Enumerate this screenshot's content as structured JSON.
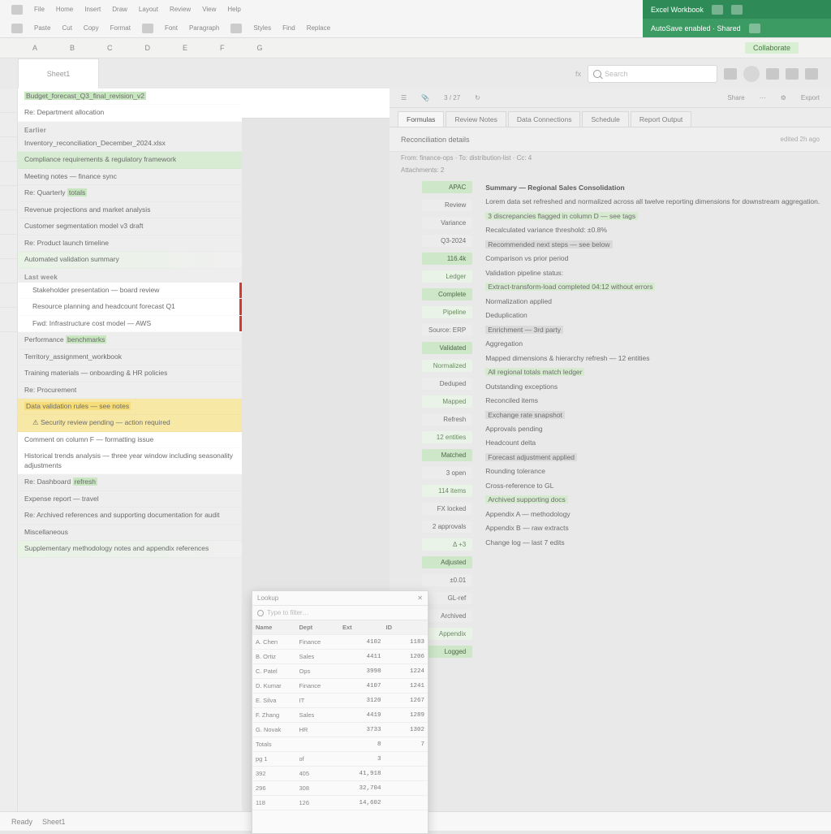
{
  "ribbon": {
    "row1": [
      "File",
      "Home",
      "Insert",
      "Draw",
      "Layout",
      "Review",
      "View",
      "Help"
    ],
    "row2": [
      "Paste",
      "Cut",
      "Copy",
      "Format",
      "Font",
      "Paragraph",
      "Styles",
      "Find",
      "Replace"
    ],
    "greenTitle": "Excel Workbook",
    "greenSub": "AutoSave enabled · Shared",
    "greenTab": "Collaborate"
  },
  "subbar": {
    "cols": [
      "A",
      "B",
      "C",
      "D",
      "E",
      "F",
      "G"
    ]
  },
  "dochead": {
    "tab": "Sheet1",
    "searchPlaceholder": "Search"
  },
  "messages": {
    "groups": [
      {
        "head": "",
        "items": [
          {
            "t": "Budget_forecast_Q3_final_revision_v2",
            "cls": "white hl-green-part"
          },
          {
            "t": "Re: Department allocation",
            "cls": "white"
          }
        ]
      },
      {
        "head": "Earlier",
        "items": [
          {
            "t": "Inventory_reconciliation_December_2024.xlsx",
            "cls": ""
          },
          {
            "t": "Compliance requirements & regulatory framework",
            "cls": "greenband"
          },
          {
            "t": "Meeting notes — finance sync",
            "cls": ""
          },
          {
            "t": "Re: Quarterly totals",
            "cls": "hl-green-part"
          }
        ]
      },
      {
        "head": "",
        "items": [
          {
            "t": "Revenue projections and market analysis",
            "cls": ""
          },
          {
            "t": "Customer segmentation model v3 draft",
            "cls": ""
          },
          {
            "t": "Re: Product launch timeline",
            "cls": ""
          },
          {
            "t": "Automated validation summary",
            "cls": "greenlite"
          }
        ]
      },
      {
        "head": "Last week",
        "items": [
          {
            "t": "Stakeholder presentation — board review",
            "cls": "white redbar indent"
          },
          {
            "t": "Resource planning and headcount forecast Q1",
            "cls": "white redbar indent"
          },
          {
            "t": "Fwd: Infrastructure cost model — AWS",
            "cls": "white redbar indent"
          }
        ]
      },
      {
        "head": "",
        "items": [
          {
            "t": "Performance benchmarks",
            "cls": "hl-green-part"
          },
          {
            "t": "Territory_assignment_workbook",
            "cls": ""
          },
          {
            "t": "Training materials — onboarding & HR policies",
            "cls": ""
          },
          {
            "t": "Re: Procurement",
            "cls": ""
          },
          {
            "t": "Data validation rules — see notes",
            "cls": "yellowband hl-yellow-part"
          },
          {
            "t": "⚠ Security review pending — action required",
            "cls": "yellowband indent"
          },
          {
            "t": "Comment on column F — formatting issue",
            "cls": "white"
          },
          {
            "t": "Historical trends analysis — three year window including seasonality adjustments",
            "cls": "white"
          },
          {
            "t": "Re: Dashboard refresh",
            "cls": "hl-green-part"
          },
          {
            "t": "Expense report — travel",
            "cls": ""
          },
          {
            "t": "Re: Archived references and supporting documentation for audit",
            "cls": ""
          },
          {
            "t": "Miscellaneous",
            "cls": ""
          },
          {
            "t": "Supplementary methodology notes and appendix references",
            "cls": "greenlite"
          }
        ]
      }
    ]
  },
  "detail": {
    "toolbarLeft": [
      "☰",
      "📎",
      "3 / 27",
      "↻"
    ],
    "toolbarRight": [
      "Share",
      "⋯",
      "⚙",
      "Export"
    ],
    "tabs": [
      "Formulas",
      "Review Notes",
      "Data Connections",
      "Schedule",
      "Report Output"
    ],
    "activeTab": 0,
    "subject": "Reconciliation details",
    "subjectRight": "edited 2h ago",
    "metaA": "From: finance-ops · To: distribution-list · Cc: 4",
    "metaB": "Attachments: 2",
    "header": "Summary — Regional Sales Consolidation",
    "lines": [
      "Lorem data set refreshed and normalized across all twelve reporting dimensions for downstream aggregation.",
      "3 discrepancies flagged in column D — see tags",
      "Recalculated variance threshold: ±0.8%",
      "Recommended next steps — see below",
      "Comparison vs prior period",
      "Validation pipeline status:",
      "Extract-transform-load completed 04:12 without errors",
      "Normalization applied",
      "Deduplication",
      "Enrichment — 3rd party",
      "Aggregation",
      "Mapped dimensions & hierarchy refresh — 12 entities",
      "All regional totals match ledger",
      "Outstanding exceptions",
      "Reconciled items",
      "Exchange rate snapshot",
      "Approvals pending",
      "Headcount delta",
      "Forecast adjustment applied",
      "Rounding tolerance",
      "Cross-reference to GL",
      "Archived supporting docs",
      "Appendix A — methodology",
      "Appendix B — raw extracts",
      "Change log — last 7 edits"
    ],
    "tags": [
      {
        "t": "APAC",
        "c": "gr"
      },
      {
        "t": "Review",
        "c": "pl"
      },
      {
        "t": "Variance",
        "c": "pl"
      },
      {
        "t": "Q3-2024",
        "c": "pl"
      },
      {
        "t": "116.4k",
        "c": "gr"
      },
      {
        "t": "Ledger",
        "c": "lt"
      },
      {
        "t": "Complete",
        "c": "gr"
      },
      {
        "t": "Pipeline",
        "c": "lt"
      },
      {
        "t": "Source: ERP",
        "c": "pl"
      },
      {
        "t": "Validated",
        "c": "gr"
      },
      {
        "t": "Normalized",
        "c": "lt"
      },
      {
        "t": "Deduped",
        "c": "pl"
      },
      {
        "t": "Mapped",
        "c": "lt"
      },
      {
        "t": "Refresh",
        "c": "pl"
      },
      {
        "t": "12 entities",
        "c": "lt"
      },
      {
        "t": "Matched",
        "c": "gr"
      },
      {
        "t": "3 open",
        "c": "pl"
      },
      {
        "t": "114 items",
        "c": "lt"
      },
      {
        "t": "FX locked",
        "c": "pl"
      },
      {
        "t": "2 approvals",
        "c": "pl"
      },
      {
        "t": "Δ +3",
        "c": "lt"
      },
      {
        "t": "Adjusted",
        "c": "gr"
      },
      {
        "t": "±0.01",
        "c": "pl"
      },
      {
        "t": "GL-ref",
        "c": "pl"
      },
      {
        "t": "Archived",
        "c": "pl"
      },
      {
        "t": "Appendix",
        "c": "lt"
      },
      {
        "t": "Logged",
        "c": "gr"
      }
    ]
  },
  "popup": {
    "title": "Lookup",
    "closeGlyph": "✕",
    "searchPlaceholder": "Type to filter…",
    "headers": [
      "Name",
      "Dept",
      "Ext",
      "ID"
    ],
    "rows": [
      [
        "A. Chen",
        "Finance",
        "4102",
        "1183"
      ],
      [
        "B. Ortiz",
        "Sales",
        "4411",
        "1206"
      ],
      [
        "C. Patel",
        "Ops",
        "3998",
        "1224"
      ],
      [
        "D. Kumar",
        "Finance",
        "4107",
        "1241"
      ],
      [
        "E. Silva",
        "IT",
        "3120",
        "1267"
      ],
      [
        "F. Zhang",
        "Sales",
        "4419",
        "1289"
      ],
      [
        "G. Novak",
        "HR",
        "3733",
        "1302"
      ],
      [
        "Totals",
        "",
        "8",
        "7"
      ],
      [
        "pg 1",
        "of",
        "3",
        ""
      ],
      [
        "392",
        "405",
        "41,918",
        ""
      ],
      [
        "296",
        "308",
        "32,704",
        ""
      ],
      [
        "118",
        "126",
        "14,602",
        ""
      ]
    ]
  },
  "status": {
    "left": "Ready",
    "sheet": "Sheet1"
  }
}
